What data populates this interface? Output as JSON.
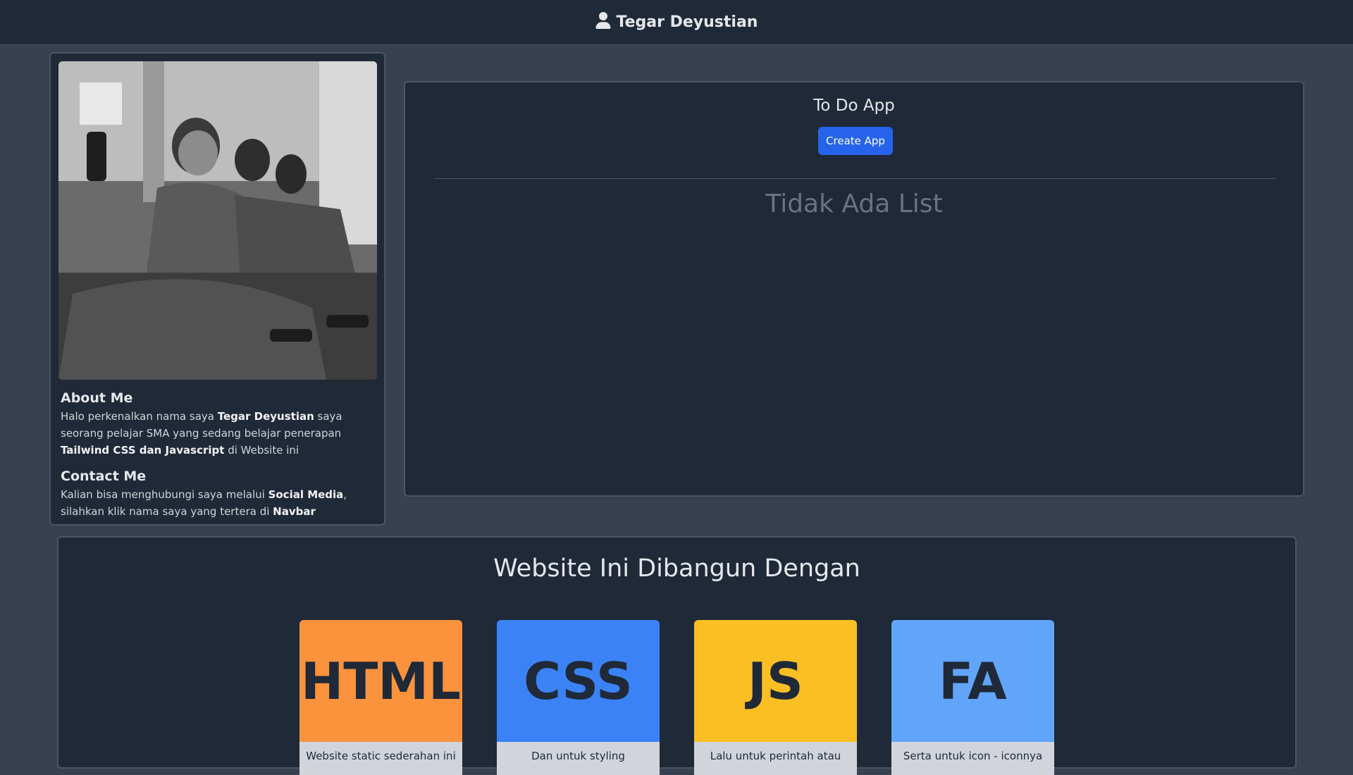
{
  "navbar": {
    "name": "Tegar Deyustian",
    "icon": "user-icon"
  },
  "profile": {
    "about_title": "About Me",
    "about_text_1": "Halo perkenalkan nama saya ",
    "about_bold_1": "Tegar Deyustian",
    "about_text_2": " saya seorang pelajar SMA yang sedang belajar penerapan ",
    "about_bold_2": "Tailwind CSS dan Javascript",
    "about_text_3": " di Website ini",
    "contact_title": "Contact Me",
    "contact_text_1": "Kalian bisa menghubungi saya melalui ",
    "contact_bold_1": "Social Media",
    "contact_text_2": ", silahkan klik nama saya yang tertera di ",
    "contact_bold_2": "Navbar"
  },
  "todo": {
    "title": "To Do App",
    "create_label": "Create App",
    "empty_text": "Tidak Ada List"
  },
  "built": {
    "title": "Website Ini Dibangun Dengan",
    "cards": [
      {
        "logo": "HTML",
        "caption": "Website static sederahan ini",
        "color": "#fb923c"
      },
      {
        "logo": "CSS",
        "caption": "Dan untuk styling",
        "color": "#3b82f6"
      },
      {
        "logo": "JS",
        "caption": "Lalu untuk perintah atau",
        "color": "#fbbf24"
      },
      {
        "logo": "FA",
        "caption": "Serta untuk icon - iconnya",
        "color": "#60a5fa"
      }
    ]
  }
}
